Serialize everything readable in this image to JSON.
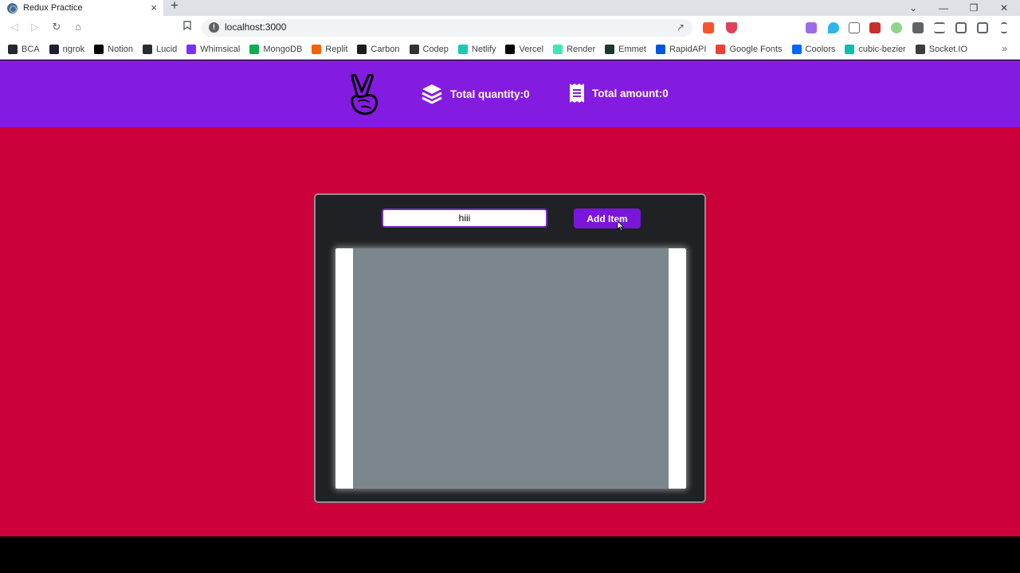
{
  "browser": {
    "tab_title": "Redux Practice",
    "tab_close": "×",
    "new_tab": "+",
    "url": "localhost:3000",
    "window_controls": [
      "⌄",
      "—",
      "❐",
      "✕"
    ]
  },
  "bookmarks": [
    {
      "label": "BCA",
      "icon": "github-icon",
      "color": "#24292e"
    },
    {
      "label": "ngrok",
      "icon": "ngrok-icon",
      "color": "#1f1e37"
    },
    {
      "label": "Notion",
      "icon": "notion-icon",
      "color": "#000000"
    },
    {
      "label": "Lucid",
      "icon": "lucid-icon",
      "color": "#282c33"
    },
    {
      "label": "Whimsical",
      "icon": "whimsical-icon",
      "color": "#7b2ff7"
    },
    {
      "label": "MongoDB",
      "icon": "mongodb-icon",
      "color": "#13aa52"
    },
    {
      "label": "Replit",
      "icon": "replit-icon",
      "color": "#f26207"
    },
    {
      "label": "Carbon",
      "icon": "carbon-icon",
      "color": "#1c1c1c"
    },
    {
      "label": "Codep",
      "icon": "codepen-icon",
      "color": "#333333"
    },
    {
      "label": "Netlify",
      "icon": "netlify-icon",
      "color": "#20c6b7"
    },
    {
      "label": "Vercel",
      "icon": "vercel-icon",
      "color": "#000000"
    },
    {
      "label": "Render",
      "icon": "render-icon",
      "color": "#46e3b7"
    },
    {
      "label": "Emmet",
      "icon": "emmet-icon",
      "color": "#1a3a2a"
    },
    {
      "label": "RapidAPI",
      "icon": "rapidapi-icon",
      "color": "#0055da"
    },
    {
      "label": "Google Fonts",
      "icon": "google-fonts-icon",
      "color": "#ea4335"
    },
    {
      "label": "Coolors",
      "icon": "coolors-icon",
      "color": "#0066ff"
    },
    {
      "label": "cubic-bezier",
      "icon": "cubic-bezier-icon",
      "color": "#16b8b0"
    },
    {
      "label": "Socket.IO",
      "icon": "socketio-icon",
      "color": "#3c3c3c"
    }
  ],
  "app": {
    "total_quantity": "Total quantity:0",
    "total_amount": "Total amount:0",
    "input_value": "hiii",
    "add_button": "Add Item"
  },
  "colors": {
    "navbar": "#841be0",
    "page_background": "#cc003a",
    "card": "#202124",
    "list_inner": "#7b878c",
    "accent": "#7a16dc"
  }
}
